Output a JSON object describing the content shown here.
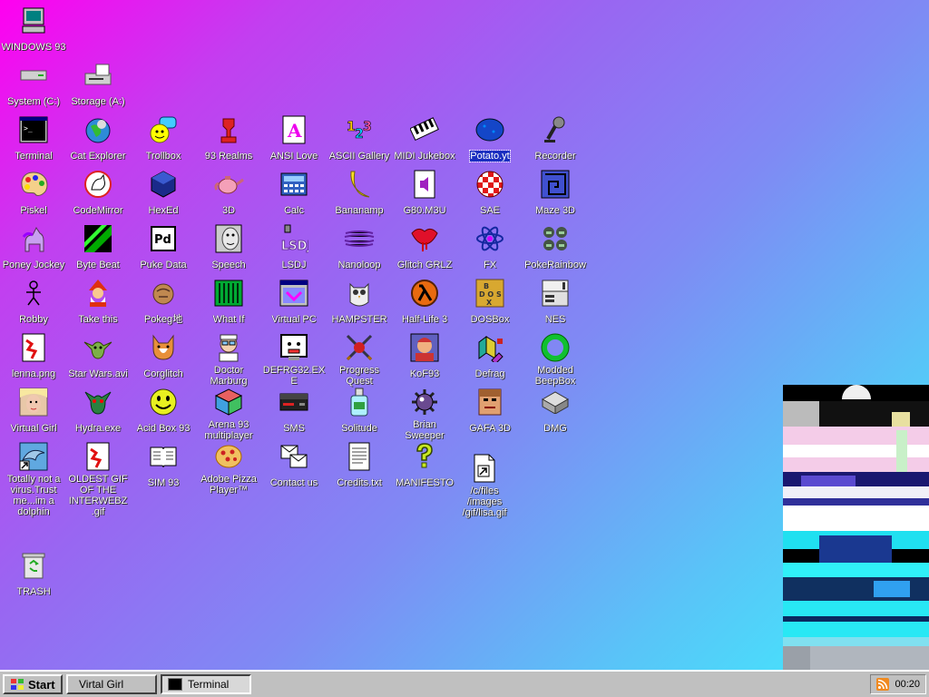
{
  "desktop": {
    "icons": [
      {
        "label": "WINDOWS 93"
      },
      {
        "label": "System (C:)"
      },
      {
        "label": "Storage (A:)"
      },
      {
        "label": "TRASH"
      },
      {
        "label": "Terminal"
      },
      {
        "label": "Cat Explorer"
      },
      {
        "label": "Trollbox"
      },
      {
        "label": "93 Realms"
      },
      {
        "label": "ANSI Love"
      },
      {
        "label": "ASCII Gallery"
      },
      {
        "label": "MIDI Jukebox"
      },
      {
        "label": "Potato.yt"
      },
      {
        "label": "Recorder"
      },
      {
        "label": "Piskel"
      },
      {
        "label": "CodeMirror"
      },
      {
        "label": "HexEd"
      },
      {
        "label": "3D"
      },
      {
        "label": "Calc"
      },
      {
        "label": "Bananamp"
      },
      {
        "label": "G80.M3U"
      },
      {
        "label": "SAE"
      },
      {
        "label": "Maze 3D"
      },
      {
        "label": "Poney Jockey"
      },
      {
        "label": "Byte Beat"
      },
      {
        "label": "Puke Data"
      },
      {
        "label": "Speech"
      },
      {
        "label": "LSDJ"
      },
      {
        "label": "Nanoloop"
      },
      {
        "label": "Glitch GRLZ"
      },
      {
        "label": "FX"
      },
      {
        "label": "PokeRainbow"
      },
      {
        "label": "Robby"
      },
      {
        "label": "Take this"
      },
      {
        "label": "Pokeg地"
      },
      {
        "label": "What If"
      },
      {
        "label": "Virtual PC"
      },
      {
        "label": "HAMPSTER"
      },
      {
        "label": "Half-Life 3"
      },
      {
        "label": "DOSBox"
      },
      {
        "label": "NES"
      },
      {
        "label": "lenna.png"
      },
      {
        "label": "Star Wars.avi"
      },
      {
        "label": "Corglitch"
      },
      {
        "label": "Doctor Marburg"
      },
      {
        "label": "DEFRG32.EXE"
      },
      {
        "label": "Progress Quest"
      },
      {
        "label": "KoF93"
      },
      {
        "label": "Defrag"
      },
      {
        "label": "Modded BeepBox"
      },
      {
        "label": "Virtual Girl"
      },
      {
        "label": "Hydra.exe"
      },
      {
        "label": "Acid Box 93"
      },
      {
        "label": "Arena 93 multiplayer"
      },
      {
        "label": "SMS"
      },
      {
        "label": "Solitude"
      },
      {
        "label": "Brian Sweeper"
      },
      {
        "label": "GAFA 3D"
      },
      {
        "label": "DMG"
      },
      {
        "label": "Totally not a virus.Trust me...im a dolphin"
      },
      {
        "label": "OLDEST GIF OF THE INTERWEBZ .gif"
      },
      {
        "label": "SIM 93"
      },
      {
        "label": "Adobe Pizza Player™"
      },
      {
        "label": "Contact us"
      },
      {
        "label": "Credits.txt"
      },
      {
        "label": "MANIFESTO"
      },
      {
        "label": "/c/files /images /gif/lisa.gif"
      }
    ]
  },
  "taskbar": {
    "start_label": "Start",
    "tasks": [
      {
        "label": "Virtal Girl"
      },
      {
        "label": "Terminal"
      }
    ],
    "clock": "00:20"
  }
}
